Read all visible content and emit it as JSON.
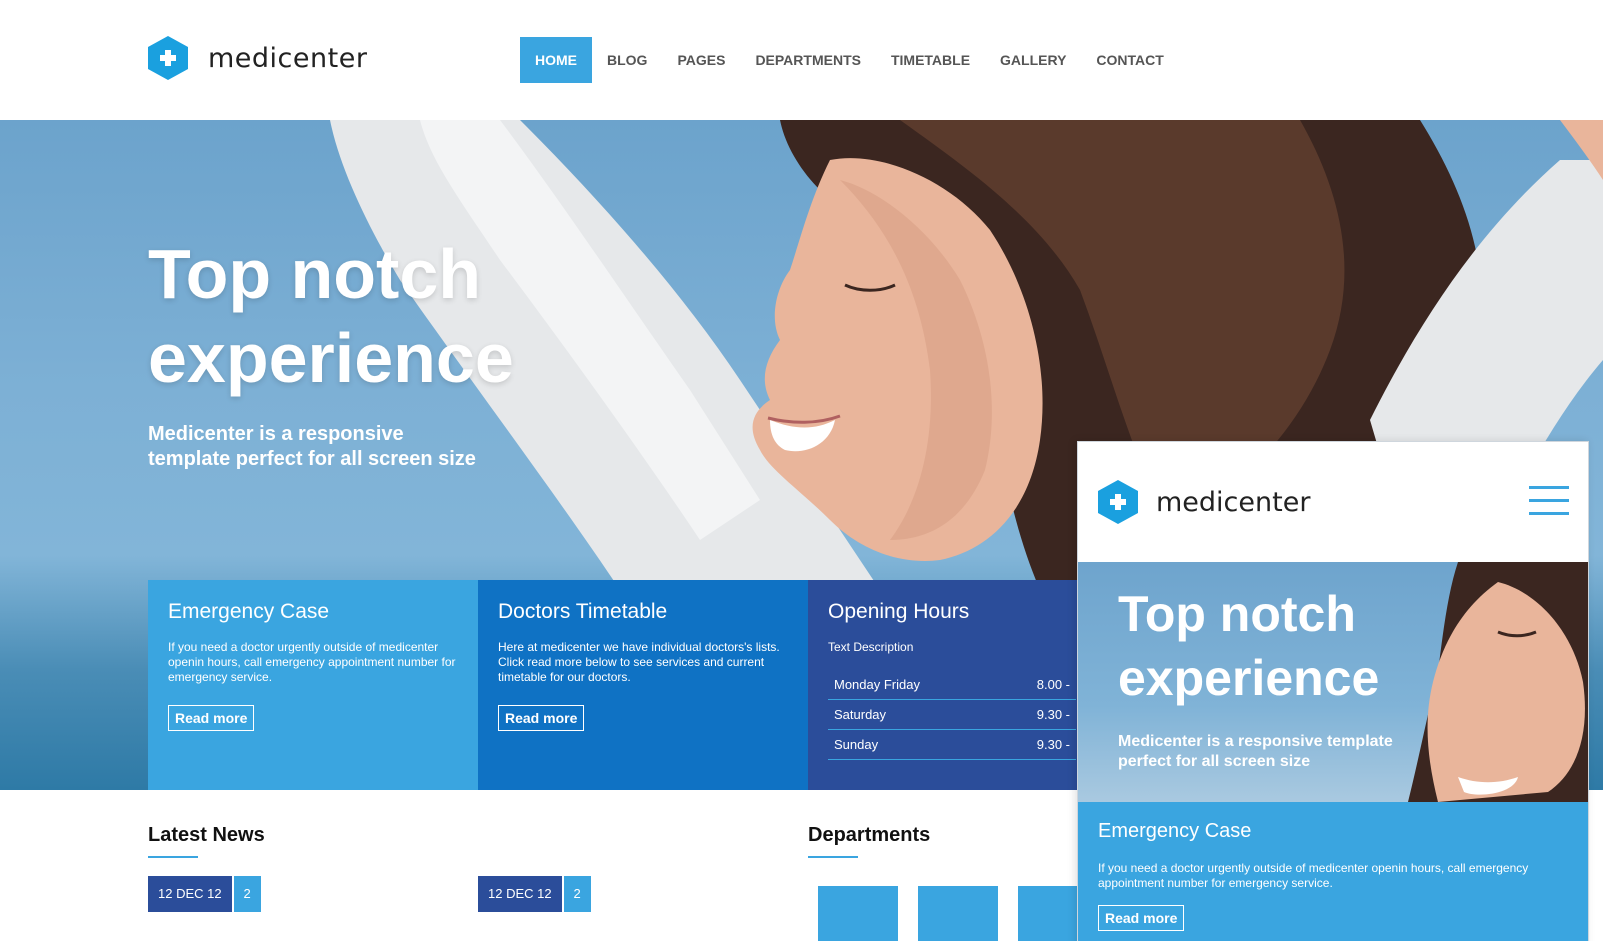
{
  "brand": {
    "name": "medicenter",
    "color": "#3aa5e0"
  },
  "nav": {
    "items": [
      "HOME",
      "BLOG",
      "PAGES",
      "DEPARTMENTS",
      "TIMETABLE",
      "GALLERY",
      "CONTACT"
    ],
    "active": "HOME"
  },
  "hero": {
    "title_line1": "Top notch",
    "title_line2": "experience",
    "subtitle_line1": "Medicenter is a responsive",
    "subtitle_line2": "template perfect for all screen size"
  },
  "boxes": {
    "emergency": {
      "title": "Emergency Case",
      "text": "If you need a doctor urgently outside of medicenter openin hours, call emergency appointment number for emergency service.",
      "button": "Read more"
    },
    "timetable": {
      "title": "Doctors Timetable",
      "text": "Here at medicenter we have individual doctors's lists. Click read more below to see services and current timetable for our doctors.",
      "button": "Read more"
    },
    "hours": {
      "title": "Opening Hours",
      "description": "Text Description",
      "rows": [
        {
          "day": "Monday Friday",
          "time": "8.00 -"
        },
        {
          "day": "Saturday",
          "time": "9.30 -"
        },
        {
          "day": "Sunday",
          "time": "9.30 -"
        }
      ]
    }
  },
  "latest_news": {
    "title": "Latest News",
    "items": [
      {
        "date": "12 DEC 12",
        "comments": "2"
      },
      {
        "date": "12 DEC 12",
        "comments": "2"
      }
    ]
  },
  "departments": {
    "title": "Departments"
  },
  "mobile_preview": {
    "brand": "medicenter",
    "hero_title_line1": "Top notch",
    "hero_title_line2": "experience",
    "hero_subtitle_line1": "Medicenter is a responsive template",
    "hero_subtitle_line2": "perfect for all screen size",
    "box_title": "Emergency Case",
    "box_text": "If you need a doctor urgently outside of medicenter openin hours, call emergency appointment number for emergency service.",
    "box_button": "Read more"
  }
}
